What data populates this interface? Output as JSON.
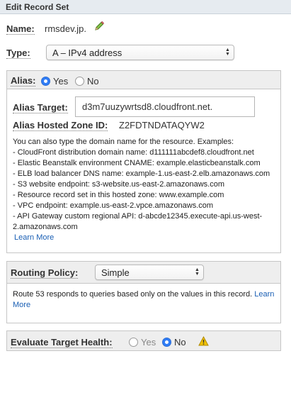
{
  "panel": {
    "title": "Edit Record Set"
  },
  "record": {
    "name_label": "Name:",
    "name_value": "rmsdev.jp.",
    "type_label": "Type:",
    "type_value": "A – IPv4 address"
  },
  "alias": {
    "label": "Alias:",
    "yes_label": "Yes",
    "no_label": "No",
    "selected": "Yes",
    "target_label": "Alias Target:",
    "target_value": "d3m7uuzywrtsd8.cloudfront.net.",
    "zone_label": "Alias Hosted Zone ID:",
    "zone_value": "Z2FDTNDATAQYW2",
    "intro": "You can also type the domain name for the resource. Examples:",
    "examples": [
      "- CloudFront distribution domain name: d111111abcdef8.cloudfront.net",
      "- Elastic Beanstalk environment CNAME: example.elasticbeanstalk.com",
      "- ELB load balancer DNS name: example-1.us-east-2.elb.amazonaws.com",
      "- S3 website endpoint: s3-website.us-east-2.amazonaws.com",
      "- Resource record set in this hosted zone: www.example.com",
      "- VPC endpoint: example.us-east-2.vpce.amazonaws.com",
      "- API Gateway custom regional API: d-abcde12345.execute-api.us-west-",
      "2.amazonaws.com"
    ],
    "learn_more": "Learn More"
  },
  "routing": {
    "label": "Routing Policy:",
    "value": "Simple",
    "description_line1": "Route 53 responds to queries based only on the values in this record.",
    "learn_more_part1": "Learn",
    "learn_more_part2": "More"
  },
  "health": {
    "label": "Evaluate Target Health:",
    "yes_label": "Yes",
    "no_label": "No",
    "selected": "No"
  },
  "icons": {
    "edit": "pencil-icon",
    "warning": "warning-icon",
    "select_arrows": "select-arrows-icon"
  },
  "colors": {
    "header_bg": "#e6ebf0",
    "radio_selected": "#2f7cf6",
    "link": "#1a5fb4",
    "warning": "#f2c200"
  }
}
